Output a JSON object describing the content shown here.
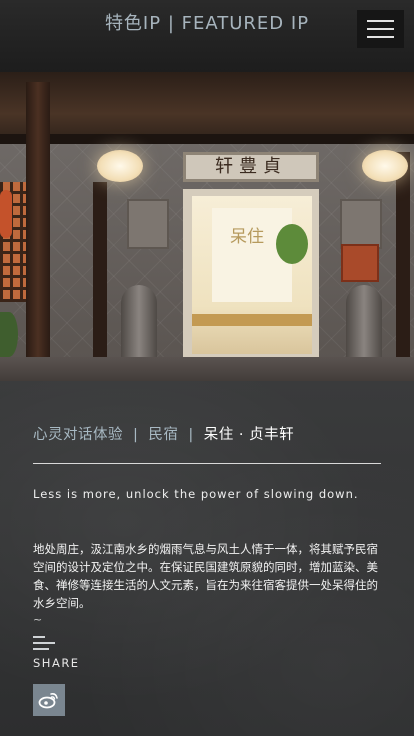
{
  "header": {
    "title": "特色IP | FEATURED IP",
    "menu_icon": "hamburger-menu-icon"
  },
  "hero": {
    "plaque_text": "轩豊貞",
    "door_logo_text": "呆住"
  },
  "breadcrumb": {
    "item1": "心灵对话体验",
    "separator": "|",
    "item2": "民宿",
    "current": "呆住 · 贞丰轩"
  },
  "content": {
    "tagline": "Less is more, unlock the power of slowing down.",
    "description": "地处周庄，汲江南水乡的烟雨气息与风土人情于一体，将其赋予民宿空间的设计及定位之中。在保证民国建筑原貌的同时，增加蓝染、美食、禅修等连接生活的人文元素，旨在为来往宿客提供一处呆得住的水乡空间。",
    "tilde": "~"
  },
  "share": {
    "label": "SHARE",
    "icon": "share-lines-icon",
    "weibo_icon": "weibo-icon"
  },
  "colors": {
    "header_bg": "#222222",
    "title_color": "#a7b4bd",
    "crumb_color": "#a8b9c3",
    "content_bg": "#343536",
    "weibo_bg": "#7a8690"
  }
}
